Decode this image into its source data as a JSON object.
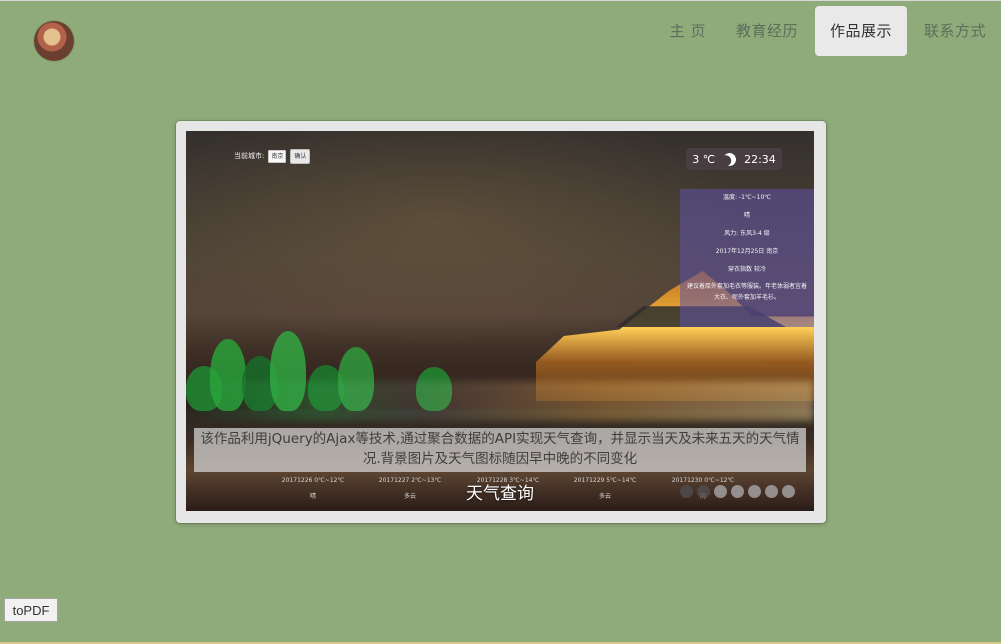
{
  "nav": {
    "items": [
      {
        "label": "主 页"
      },
      {
        "label": "教育经历"
      },
      {
        "label": "作品展示"
      },
      {
        "label": "联系方式"
      }
    ],
    "active_index": 2
  },
  "showcase": {
    "caption": "该作品利用jQuery的Ajax等技术,通过聚合数据的API实现天气查询，并显示当天及未来五天的天气情况.背景图片及天气图标随因早中晚的不同变化",
    "title": "天气查询",
    "dots_count": 7,
    "screenshot": {
      "city_label": "当前城市:",
      "city_value": "南京",
      "confirm_label": "确认",
      "temp": "3 ℃",
      "time": "22:34",
      "panel": {
        "line1": "温度: -1℃~10℃",
        "line2": "晴",
        "line3": "风力: 东风3-4 级",
        "line4": "2017年12月25日  南京",
        "line5": "穿衣指数  较冷",
        "line6": "建议着厚外套加毛衣等服装。年老体弱者宜着大衣、呢外套加羊毛衫。"
      },
      "forecast": [
        {
          "date": "20171226  0℃~12℃",
          "cond": "晴"
        },
        {
          "date": "20171227  2℃~13℃",
          "cond": "多云"
        },
        {
          "date": "20171228  3℃~14℃",
          "cond": "多云"
        },
        {
          "date": "20171229  5℃~14℃",
          "cond": "多云"
        },
        {
          "date": "20171230  0℃~12℃",
          "cond": "阴"
        }
      ]
    }
  },
  "toolbar": {
    "topdf_label": "toPDF"
  },
  "colors": {
    "background": "#8fab79",
    "nav_active": "#e9e9e9",
    "frame": "#e6e6e6"
  }
}
